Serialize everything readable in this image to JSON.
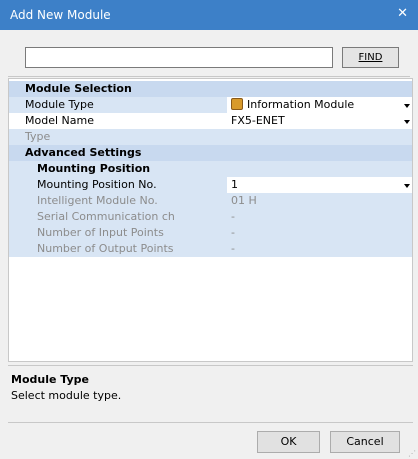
{
  "window": {
    "title": "Add New Module",
    "close_glyph": "✕"
  },
  "search": {
    "value": "",
    "find_label": "FIND"
  },
  "grid": {
    "module_selection": "Module Selection",
    "module_type_label": "Module Type",
    "module_type_value": "Information Module",
    "model_name_label": "Model Name",
    "model_name_value": "FX5-ENET",
    "type_label": "Type",
    "type_value": "",
    "advanced_settings": "Advanced Settings",
    "mounting_position": "Mounting Position",
    "mounting_position_no_label": "Mounting Position No.",
    "mounting_position_no_value": "1",
    "intelligent_module_no_label": "Intelligent Module No.",
    "intelligent_module_no_value": "01 H",
    "serial_comm_label": "Serial Communication ch",
    "serial_comm_value": "-",
    "input_points_label": "Number of Input Points",
    "input_points_value": "-",
    "output_points_label": "Number of Output Points",
    "output_points_value": "-"
  },
  "description": {
    "title": "Module Type",
    "text": "Select module type."
  },
  "buttons": {
    "ok": "OK",
    "cancel": "Cancel"
  },
  "icons": {
    "module_type_icon": "information-module-icon"
  },
  "colors": {
    "titlebar": "#3d80c8",
    "category": "#c8d9ef",
    "row_bg": "#d8e5f4"
  }
}
